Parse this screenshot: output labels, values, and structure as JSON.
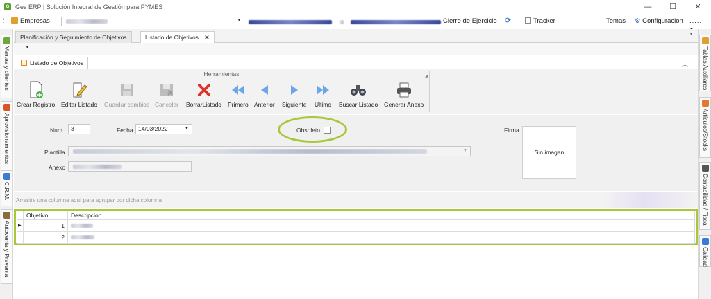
{
  "window": {
    "title": "Ges ERP | Solución Integral de Gestión para PYMES",
    "app_icon": "erp-logo-icon",
    "controls": {
      "minimize": "—",
      "maximize": "☐",
      "close": "✕"
    }
  },
  "menubar": {
    "empresas_label": "Empresas",
    "cierre_label": "Cierre de Ejercicio",
    "tracker_label": "Tracker",
    "temas_label": "Temas",
    "configuracion_label": "Configuracion",
    "more_label": "......"
  },
  "left_rail": [
    {
      "label": "Ventas y clientes",
      "icon": "sales-icon"
    },
    {
      "label": "Aprovisionamientos",
      "icon": "supply-icon"
    },
    {
      "label": "C.R.M.",
      "icon": "crm-icon"
    },
    {
      "label": "Autoventa y Preventa",
      "icon": "truck-icon"
    }
  ],
  "right_rail": [
    {
      "label": "Tablas Auxiliares",
      "icon": "table-icon"
    },
    {
      "label": "Artículos/Stocks",
      "icon": "box-icon"
    },
    {
      "label": "Contabilidad / Fiscal",
      "icon": "accounting-icon"
    },
    {
      "label": "Calidad",
      "icon": "quality-icon"
    }
  ],
  "doc_tabs": [
    {
      "label": "Planificación y Seguimiento de Objetivos"
    },
    {
      "label": "Listado de Objetivos",
      "close": "✕"
    }
  ],
  "inner_tab": {
    "label": "Listado de Objetivos"
  },
  "ribbon": {
    "group_caption": "Herramientas",
    "buttons": [
      {
        "label": "Crear Registro",
        "icon": "new-document-icon"
      },
      {
        "label": "Editar Listado",
        "icon": "edit-icon"
      },
      {
        "label": "Guardar cambios",
        "icon": "save-icon"
      },
      {
        "label": "Cancelar",
        "icon": "cancel-save-icon"
      },
      {
        "label": "BorrarListado",
        "icon": "delete-icon"
      },
      {
        "label": "Primero",
        "icon": "first-icon"
      },
      {
        "label": "Anterior",
        "icon": "previous-icon"
      },
      {
        "label": "Siguiente",
        "icon": "next-icon"
      },
      {
        "label": "Ultimo",
        "icon": "last-icon"
      },
      {
        "label": "Buscar Listado",
        "icon": "binoculars-icon"
      },
      {
        "label": "Generar Anexo",
        "icon": "printer-icon"
      }
    ]
  },
  "form": {
    "num_label": "Num.",
    "num_value": "3",
    "fecha_label": "Fecha",
    "fecha_value": "14/03/2022",
    "obsoleto_label": "Obsoleto",
    "firma_label": "Firma",
    "firma_image_text": "Sin imagen",
    "plantilla_label": "Plantilla",
    "anexo_label": "Anexo"
  },
  "grid": {
    "group_hint": "Arrastre una columna aquí para agrupar por dicha columna",
    "columns": [
      "Objetivo",
      "Descripcion"
    ],
    "rows": [
      {
        "objetivo": "1"
      },
      {
        "objetivo": "2"
      }
    ]
  },
  "colors": {
    "highlight": "#a8c83a",
    "accent_blue": "#3a7bd5",
    "delete_red": "#d9332b"
  }
}
